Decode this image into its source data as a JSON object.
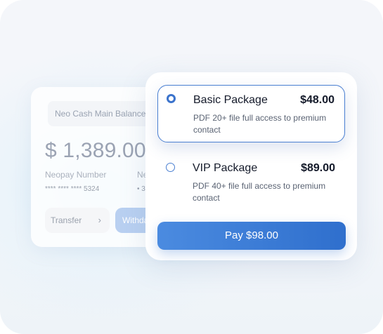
{
  "balance_card": {
    "label": "Neo Cash Main Balance",
    "amount": "$ 1,389.00",
    "neopay_label": "Neopay Number",
    "neopay_value": "**** **** ****  5324",
    "second_label": "Ne",
    "second_value": "• 3",
    "transfer_label": "Transfer",
    "withdraw_label": "Withda"
  },
  "packages": [
    {
      "title": "Basic Package",
      "price": "$48.00",
      "description": "PDF 20+ file full access to premium contact",
      "selected": true
    },
    {
      "title": "VIP Package",
      "price": "$89.00",
      "description": "PDF  40+ file full access to premium contact",
      "selected": false
    }
  ],
  "pay_button": {
    "label": "Pay $98.00"
  },
  "colors": {
    "accent": "#3b73cc",
    "pay_gradient_start": "#4b8be0",
    "pay_gradient_end": "#2f6fcd",
    "withdraw_bg": "#b9d0f1"
  }
}
